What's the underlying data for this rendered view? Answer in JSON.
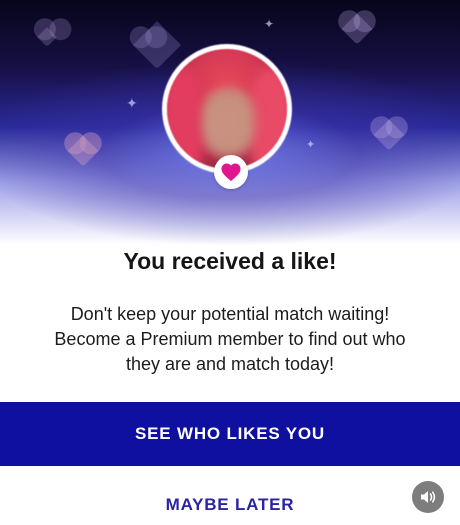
{
  "modal": {
    "title": "You received a like!",
    "body_lines": [
      "Don't keep your potential match waiting!",
      "Become a Premium member to find out who",
      "they are and match today!"
    ],
    "primary_button": "SEE WHO LIKES YOU",
    "secondary_button": "MAYBE LATER"
  },
  "icons": {
    "like_badge": "heart-icon",
    "sound_toggle": "speaker-icon",
    "decorations": "heart-icon"
  },
  "colors": {
    "primary_button_bg": "#0f0fa0",
    "secondary_button_text": "#2a23a2",
    "like_heart": "#e0168f",
    "hero_top": "#07051a",
    "hero_mid": "#2a2a9a"
  }
}
